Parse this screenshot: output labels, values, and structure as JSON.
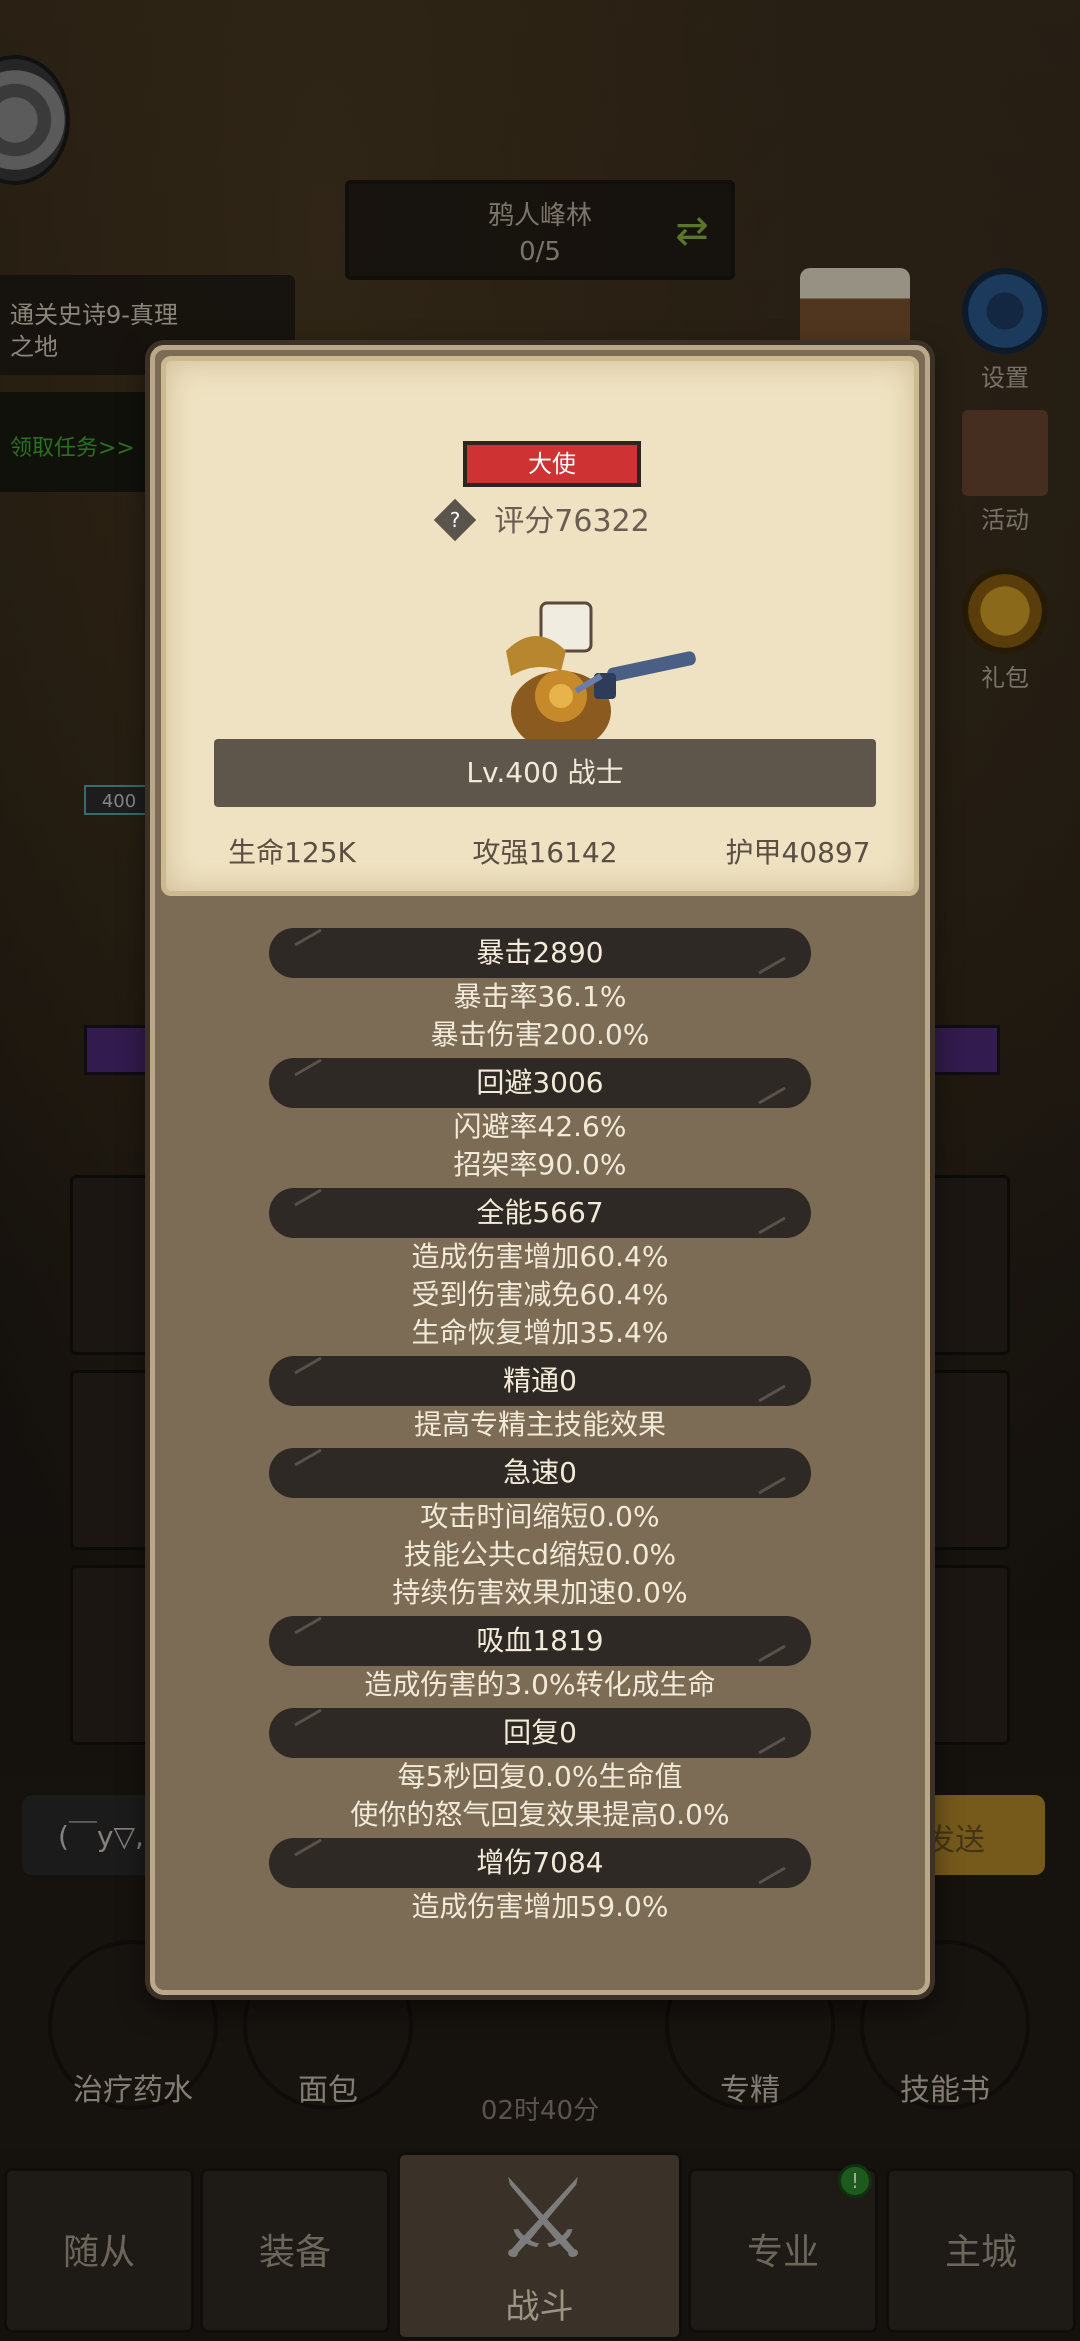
{
  "background": {
    "stage_name": "鸦人峰林",
    "stage_progress": "0/5",
    "quest_text": "通关史诗9-真理之地",
    "quest_claim": "领取任务>>",
    "side_buttons": [
      "设置",
      "活动",
      "礼包"
    ],
    "level_chip": "400",
    "chat_placeholder": "(￣y▽,",
    "send_label": "发送",
    "items": [
      "治疗药水",
      "面包",
      "专精",
      "技能书"
    ],
    "timer": "02时40分",
    "nav": [
      "随从",
      "装备",
      "战斗",
      "专业",
      "主城"
    ],
    "nav_active": "战斗"
  },
  "hero_card": {
    "rank": "大使",
    "score": "评分76322",
    "level_class": "Lv.400 战士",
    "hp": "生命125K",
    "attack": "攻强16142",
    "armor": "护甲40897"
  },
  "attributes": [
    {
      "head": "暴击2890",
      "subs": [
        "暴击率36.1%",
        "暴击伤害200.0%"
      ]
    },
    {
      "head": "回避3006",
      "subs": [
        "闪避率42.6%",
        "招架率90.0%"
      ]
    },
    {
      "head": "全能5667",
      "subs": [
        "造成伤害增加60.4%",
        "受到伤害减免60.4%",
        "生命恢复增加35.4%"
      ]
    },
    {
      "head": "精通0",
      "subs": [
        "提高专精主技能效果"
      ]
    },
    {
      "head": "急速0",
      "subs": [
        "攻击时间缩短0.0%",
        "技能公共cd缩短0.0%",
        "持续伤害效果加速0.0%"
      ]
    },
    {
      "head": "吸血1819",
      "subs": [
        "造成伤害的3.0%转化成生命"
      ]
    },
    {
      "head": "回复0",
      "subs": [
        "每5秒回复0.0%生命值",
        "使你的怒气回复效果提高0.0%"
      ]
    },
    {
      "head": "增伤7084",
      "subs": [
        "造成伤害增加59.0%"
      ]
    }
  ]
}
